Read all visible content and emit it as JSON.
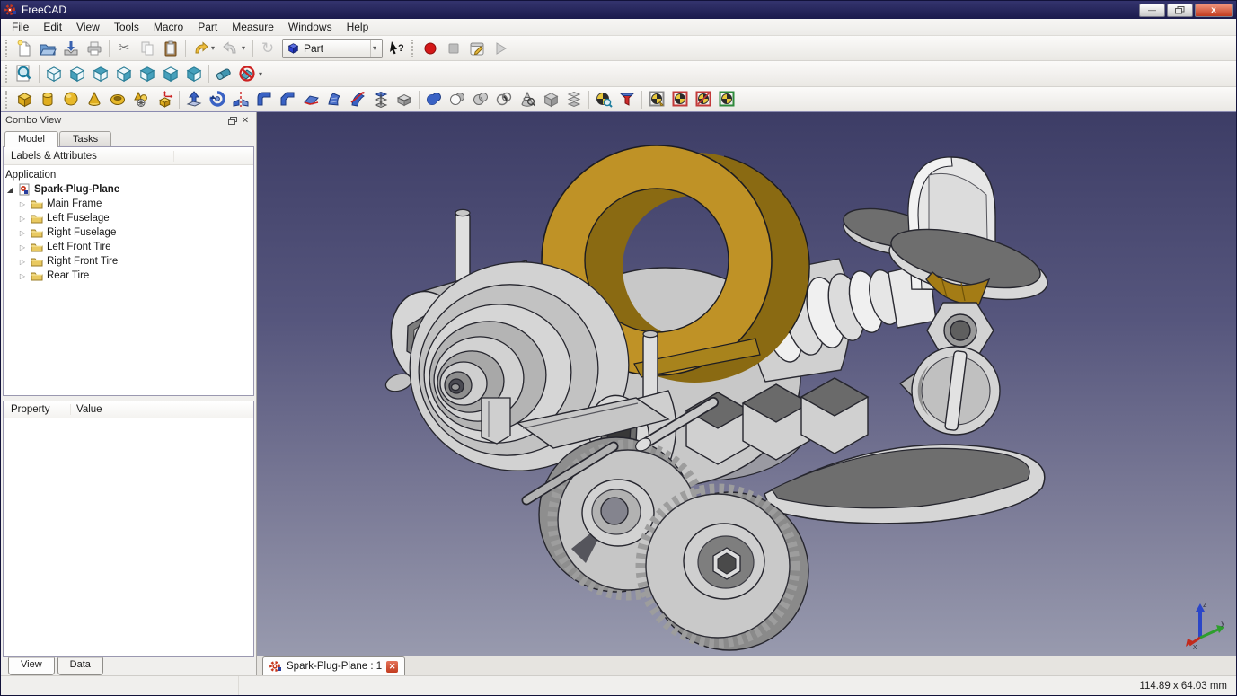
{
  "window": {
    "title": "FreeCAD"
  },
  "titlebar": {
    "controls": [
      "minimize",
      "restore",
      "close"
    ],
    "close_glyph": "x",
    "minimize_glyph": "—"
  },
  "menubar": {
    "items": [
      "File",
      "Edit",
      "View",
      "Tools",
      "Macro",
      "Part",
      "Measure",
      "Windows",
      "Help"
    ]
  },
  "toolbars": {
    "standard": {
      "icons": [
        "new-file",
        "open-folder",
        "save",
        "print",
        "cut",
        "copy",
        "paste",
        "undo",
        "redo",
        "refresh"
      ]
    },
    "workbench_selector": {
      "value": "Part",
      "icon": "part-workbench-cube"
    },
    "help": {
      "icons": [
        "whats-this"
      ]
    },
    "macro": {
      "icons": [
        "macro-record",
        "macro-stop",
        "macro-edit",
        "macro-play"
      ]
    },
    "view": {
      "icons": [
        "fit-all",
        "view-axonometric",
        "view-front",
        "view-top",
        "view-right",
        "view-rear",
        "view-bottom",
        "view-left",
        "clear-measurement",
        "toggle-measurement"
      ]
    },
    "part": {
      "icons": [
        "box",
        "cylinder",
        "sphere",
        "cone",
        "torus",
        "create-primitives",
        "shape-builder",
        "extrude",
        "revolve",
        "mirror",
        "fillet",
        "chamfer",
        "make-face",
        "ruled-surface",
        "sweep",
        "loft",
        "thickness",
        "union",
        "cut-boolean",
        "common",
        "section",
        "cross-sections",
        "compound",
        "explode-compound",
        "check-geometry",
        "defeaturing",
        "boolean-fragments",
        "slice-apart",
        "slice",
        "xor"
      ]
    }
  },
  "combo_view": {
    "title": "Combo View",
    "tabs": [
      "Model",
      "Tasks"
    ],
    "active_tab": "Model",
    "tree_header": "Labels & Attributes",
    "tree": {
      "root": "Application",
      "document": "Spark-Plug-Plane",
      "items": [
        "Main Frame",
        "Left Fuselage",
        "Right Fuselage",
        "Left Front Tire",
        "Right Front Tire",
        "Rear Tire"
      ]
    },
    "property_panel": {
      "columns": [
        "Property",
        "Value"
      ]
    },
    "bottom_tabs": [
      "View",
      "Data"
    ]
  },
  "document_tab": {
    "label": "Spark-Plug-Plane : 1"
  },
  "viewport": {
    "background_top": "#3d3d66",
    "background_bottom": "#989aae",
    "axis_labels": [
      "z",
      "y",
      "x"
    ],
    "model": {
      "name": "Spark-Plug-Plane",
      "parts": [
        "Main Frame",
        "Left Fuselage",
        "Right Fuselage",
        "Left Front Tire",
        "Right Front Tire",
        "Rear Tire"
      ],
      "colors": {
        "body_light": "#d6d6d6",
        "body_mid": "#c2c2c2",
        "body_dark": "#6e6e6e",
        "gold": "#bf9226",
        "gold_dark": "#8a6a12",
        "outline": "#1c1c1c"
      }
    }
  },
  "statusbar": {
    "dimensions": "114.89 x 64.03 mm"
  }
}
